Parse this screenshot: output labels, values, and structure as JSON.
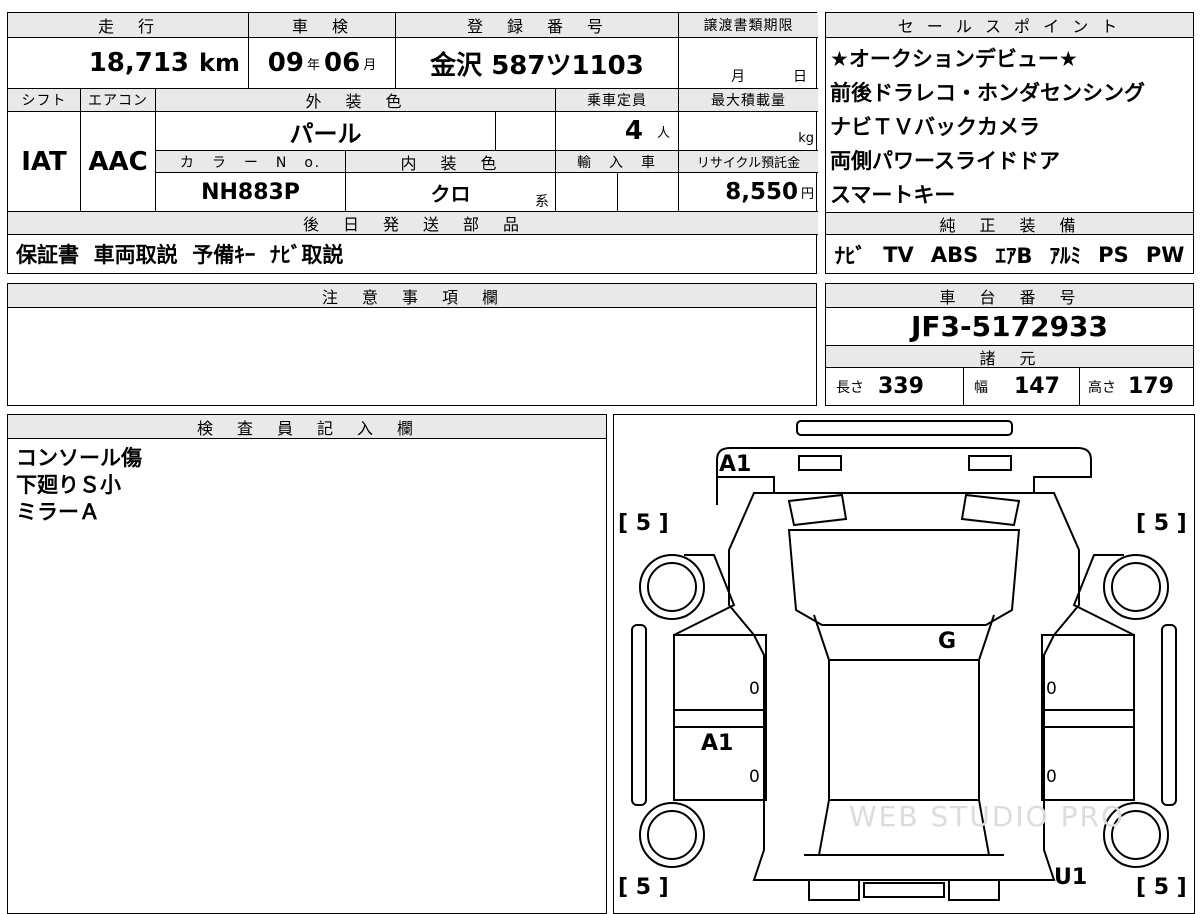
{
  "main": {
    "headers": {
      "mileage": "走　行",
      "shaken": "車　検",
      "registration": "登　録　番　号",
      "transfer_deadline": "譲渡書類期限",
      "shift": "シフト",
      "aircon": "エアコン",
      "exterior_color": "外　装　色",
      "capacity": "乗車定員",
      "max_load": "最大積載量",
      "color_no": "カ　ラ　ー　N　o.",
      "interior_color": "内　装　色",
      "import": "輸　入　車",
      "recycle": "リサイクル預託金",
      "later_parts": "後　日　発　送　部　品",
      "notes": "注　意　事　項　欄",
      "inspector": "検　査　員　記　入　欄"
    },
    "mileage": "18,713",
    "mileage_unit": "km",
    "shaken_year": "09",
    "shaken_year_unit": "年",
    "shaken_month": "06",
    "shaken_month_unit": "月",
    "registration": "金沢 587ツ1103",
    "transfer_month_unit": "月",
    "transfer_day_unit": "日",
    "shift": "IAT",
    "aircon": "AAC",
    "exterior_color": "パール",
    "capacity": "4",
    "capacity_unit": "人",
    "max_load_unit": "kg",
    "color_no": "NH883P",
    "interior_color": "クロ",
    "interior_suffix": "系",
    "recycle_fee": "8,550",
    "recycle_unit": "円",
    "later_parts": "保証書  車両取説  予備ｷｰ  ﾅﾋﾞ取説",
    "inspector_lines": [
      "コンソール傷",
      "下廻りＳ小",
      "ミラーＡ"
    ]
  },
  "side": {
    "sales_header": "セ ー ル ス ポ イ ン ト",
    "sales_points": [
      "★オークションデビュー★",
      "前後ドラレコ・ホンダセンシング",
      "ナビＴＶバックカメラ",
      "両側パワースライドドア",
      "スマートキー"
    ],
    "equipment_header": "純　正　装　備",
    "equipment": [
      "ﾅﾋﾞ",
      "TV",
      "ABS",
      "ｴｱB",
      "ｱﾙﾐ",
      "PS",
      "PW"
    ],
    "chassis_header": "車　台　番　号",
    "chassis_no": "JF3-5172933",
    "specs_header": "諸　元",
    "length_label": "長さ",
    "length": "339",
    "width_label": "幅",
    "width": "147",
    "height_label": "高さ",
    "height": "179"
  },
  "diagram": {
    "tire_marks": [
      "[ 5 ]",
      "[ 5 ]",
      "[ 5 ]",
      "[ 5 ]"
    ],
    "marks": [
      "A1",
      "G",
      "A1",
      "U1"
    ],
    "zeros": [
      "0",
      "0",
      "0",
      "0"
    ],
    "watermark": "WEB STUDIO PRO"
  }
}
